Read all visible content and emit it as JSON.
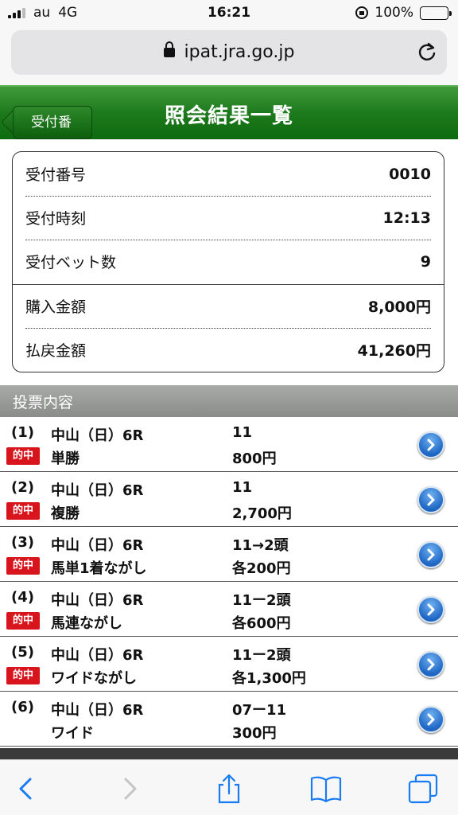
{
  "status_bar": {
    "carrier": "au",
    "network": "4G",
    "time": "16:21",
    "battery": "100%"
  },
  "browser": {
    "url": "ipat.jra.go.jp"
  },
  "header": {
    "back_label": "受付番号",
    "title": "照会結果一覧",
    "color": "#1d7a1c"
  },
  "summary": {
    "receipt_number_label": "受付番号",
    "receipt_number": "0010",
    "receipt_time_label": "受付時刻",
    "receipt_time": "12:13",
    "bet_count_label": "受付ベット数",
    "bet_count": "9",
    "purchase_amount_label": "購入金額",
    "purchase_amount": "8,000円",
    "payout_amount_label": "払戻金額",
    "payout_amount": "41,260円"
  },
  "section": {
    "title": "投票内容"
  },
  "bets": [
    {
      "num": "(1)",
      "race": "中山（日）6R",
      "horse": "11",
      "hit": "的中",
      "bet_type": "単勝",
      "amount": "800円"
    },
    {
      "num": "(2)",
      "race": "中山（日）6R",
      "horse": "11",
      "hit": "的中",
      "bet_type": "複勝",
      "amount": "2,700円"
    },
    {
      "num": "(3)",
      "race": "中山（日）6R",
      "horse": "11→2頭",
      "hit": "的中",
      "bet_type": "馬単1着ながし",
      "amount": "各200円"
    },
    {
      "num": "(4)",
      "race": "中山（日）6R",
      "horse": "11ー2頭",
      "hit": "的中",
      "bet_type": "馬連ながし",
      "amount": "各600円"
    },
    {
      "num": "(5)",
      "race": "中山（日）6R",
      "horse": "11ー2頭",
      "hit": "的中",
      "bet_type": "ワイドながし",
      "amount": "各1,300円"
    },
    {
      "num": "(6)",
      "race": "中山（日）6R",
      "horse": "07ー11",
      "hit": "",
      "bet_type": "ワイド",
      "amount": "300円"
    }
  ],
  "hit_color": "#d8141c",
  "toolbar": {
    "icons": [
      "back-icon",
      "forward-icon",
      "share-icon",
      "bookmarks-icon",
      "tabs-icon"
    ]
  }
}
